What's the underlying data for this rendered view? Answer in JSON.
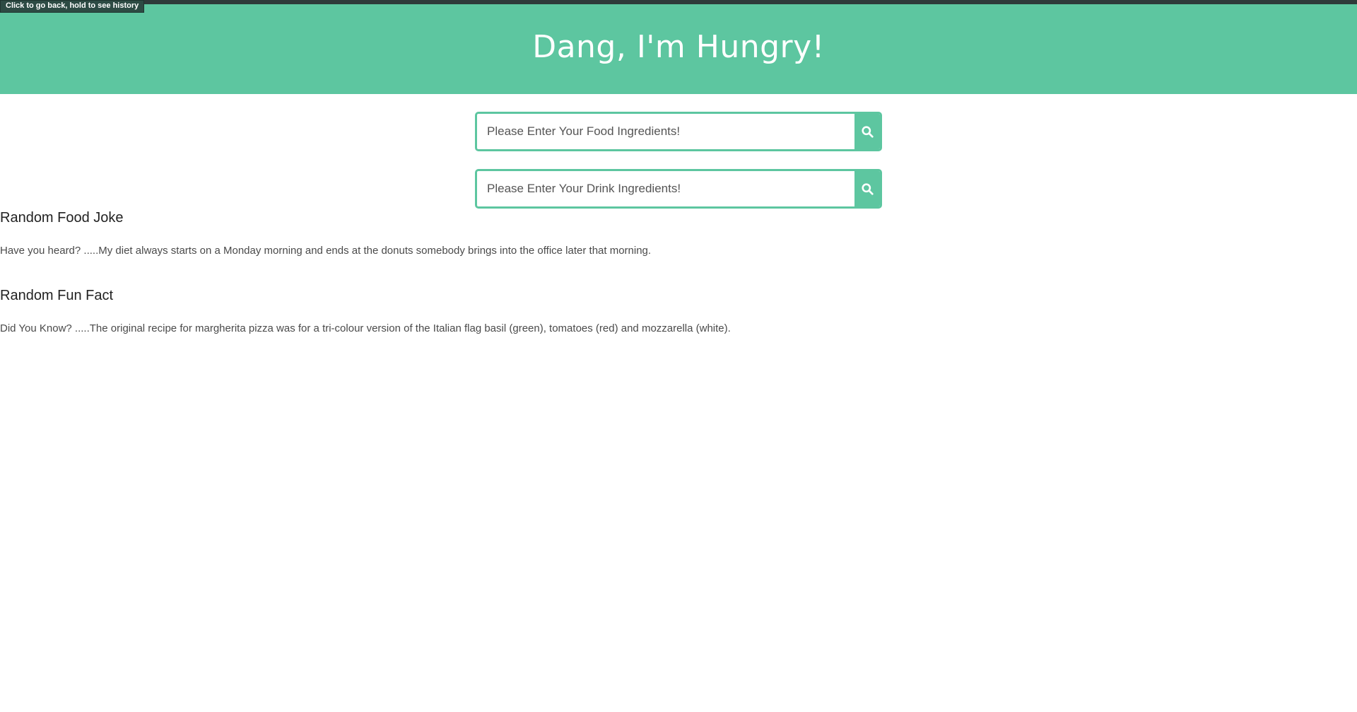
{
  "tooltip": {
    "text": "Click to go back, hold to see history"
  },
  "header": {
    "title": "Dang, I'm Hungry!"
  },
  "search_food": {
    "placeholder": "Please Enter Your Food Ingredients!",
    "value": "",
    "button_icon": "search-icon"
  },
  "search_drink": {
    "placeholder": "Please Enter Your Drink Ingredients!",
    "value": "",
    "button_icon": "search-icon"
  },
  "joke": {
    "title": "Random Food Joke",
    "text": "Have you heard? .....My diet always starts on a Monday morning and ends at the donuts somebody brings into the office later that morning."
  },
  "fact": {
    "title": "Random Fun Fact",
    "text": "Did You Know? .....The original recipe for margherita pizza was for a tri-colour version of the Italian flag basil (green), tomatoes (red) and mozzarella (white)."
  },
  "colors": {
    "accent": "#5dc6a0",
    "header_text": "#ffffff",
    "top_strip": "#2e3a3a"
  }
}
